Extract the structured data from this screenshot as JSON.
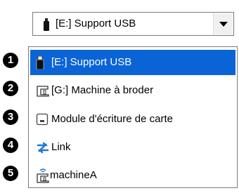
{
  "combo": {
    "selected_label": "[E:] Support USB",
    "selected_icon": "usb-drive-icon"
  },
  "list": {
    "items": [
      {
        "number": "1",
        "label": "[E:] Support USB",
        "icon": "usb-drive-icon",
        "selected": true
      },
      {
        "number": "2",
        "label": "[G:] Machine à broder",
        "icon": "embroidery-machine-icon",
        "selected": false
      },
      {
        "number": "3",
        "label": "Module d'écriture de carte",
        "icon": "card-writer-icon",
        "selected": false
      },
      {
        "number": "4",
        "label": "Link",
        "icon": "link-arrows-icon",
        "selected": false
      },
      {
        "number": "5",
        "label": "machineA",
        "icon": "wireless-machine-icon",
        "selected": false
      }
    ]
  },
  "colors": {
    "selection": "#0a64d6",
    "border": "#7a7a7a"
  }
}
